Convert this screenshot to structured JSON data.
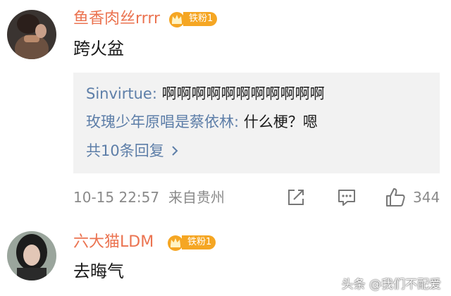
{
  "comments": [
    {
      "username": "鱼香肉丝rrrr",
      "badge": "铁粉1",
      "text": "跨火盆",
      "replies": [
        {
          "name": "Sinvirtue:",
          "text": " 啊啊啊啊啊啊啊啊啊啊啊"
        },
        {
          "name": "玫瑰少年原唱是蔡依林:",
          "text": " 什么梗？嗯"
        }
      ],
      "more_replies": "共10条回复",
      "timestamp": "10-15 22:57",
      "location": "来自贵州",
      "likes": "344"
    },
    {
      "username": "六大猫LDM",
      "badge": "铁粉1",
      "text": "去晦气"
    }
  ],
  "icons": {
    "share": "share-icon",
    "comment": "comment-icon",
    "like": "thumbs-up-icon",
    "chevron": "chevron-right-icon",
    "crown": "crown-icon"
  },
  "colors": {
    "username": "#eb7350",
    "reply_name": "#5d7ea8",
    "badge": "#f5a623",
    "meta": "#8a8a8a",
    "reply_bg": "#f2f2f2"
  },
  "watermark": "头条 @我们不配爱"
}
